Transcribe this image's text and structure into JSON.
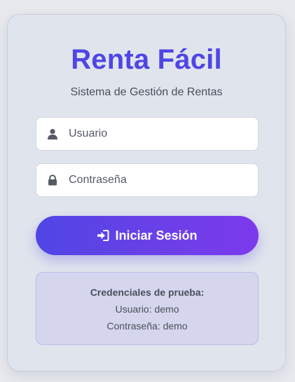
{
  "app": {
    "title": "Renta Fácil",
    "subtitle": "Sistema de Gestión de Rentas"
  },
  "form": {
    "username": {
      "placeholder": "Usuario",
      "value": "",
      "icon": "user-icon"
    },
    "password": {
      "placeholder": "Contraseña",
      "value": "",
      "icon": "lock-icon"
    },
    "submit": {
      "label": "Iniciar Sesión",
      "icon": "sign-in-icon"
    }
  },
  "demo_credentials": {
    "title": "Credenciales de prueba:",
    "user_line": "Usuario: demo",
    "password_line": "Contraseña: demo"
  },
  "colors": {
    "accent": "#4f46e5",
    "accent_end": "#7c3aed",
    "background": "#e7e9ee",
    "card": "#e0e4ec",
    "info_box": "#d5d6ee"
  }
}
